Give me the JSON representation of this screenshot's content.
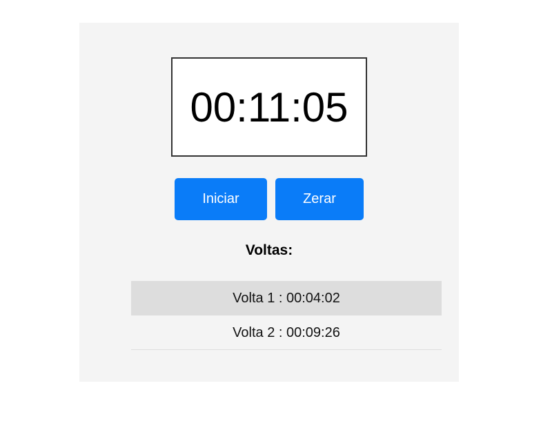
{
  "stopwatch": {
    "time": "00:11:05"
  },
  "controls": {
    "start_label": "Iniciar",
    "reset_label": "Zerar"
  },
  "laps": {
    "heading": "Voltas:",
    "items": [
      {
        "label": "Volta 1 : 00:04:02"
      },
      {
        "label": "Volta 2 : 00:09:26"
      }
    ]
  },
  "colors": {
    "panel_bg": "#f4f4f4",
    "button_bg": "#0a7cf8",
    "button_text": "#ffffff",
    "highlight_row": "#dddddd",
    "display_border": "#333333"
  }
}
